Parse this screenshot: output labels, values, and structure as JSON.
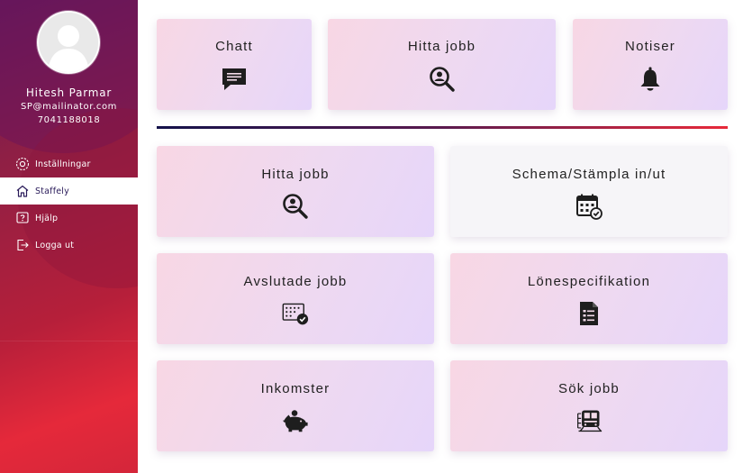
{
  "user": {
    "name": "Hitesh Parmar",
    "email": "SP@mailinator.com",
    "phone": "7041188018"
  },
  "nav": {
    "items": [
      {
        "label": "Inställningar",
        "icon": "settings-icon",
        "active": false
      },
      {
        "label": "Staffely",
        "icon": "home-icon",
        "active": true
      },
      {
        "label": "Hjälp",
        "icon": "help-icon",
        "active": false
      },
      {
        "label": "Logga ut",
        "icon": "logout-icon",
        "active": false
      }
    ]
  },
  "top_cards": [
    {
      "label": "Chatt",
      "icon": "chat-icon"
    },
    {
      "label": "Hitta jobb",
      "icon": "search-job-icon"
    },
    {
      "label": "Notiser",
      "icon": "bell-icon"
    }
  ],
  "grid_cards": [
    {
      "label": "Hitta jobb",
      "icon": "search-job-icon"
    },
    {
      "label": "Schema/Stämpla in/ut",
      "icon": "calendar-check-icon"
    },
    {
      "label": "Avslutade jobb",
      "icon": "completed-jobs-icon"
    },
    {
      "label": "Lönespecifikation",
      "icon": "payslip-icon"
    },
    {
      "label": "Inkomster",
      "icon": "piggy-bank-icon"
    },
    {
      "label": "Sök jobb",
      "icon": "train-icon"
    }
  ],
  "colors": {
    "sidebar_start": "#5e1a5e",
    "sidebar_end": "#e5293a",
    "card_gradient_start": "#f8d7e4",
    "card_gradient_end": "#e6d6fa",
    "separator_start": "#14124a",
    "separator_end": "#e8293a",
    "active_text": "#2a1b5a"
  }
}
